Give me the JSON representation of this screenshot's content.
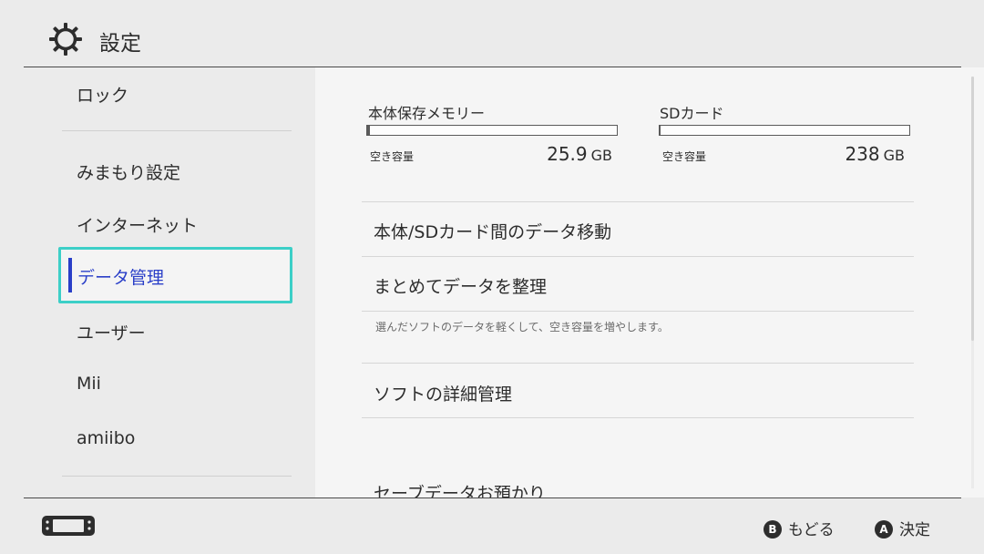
{
  "header": {
    "title": "設定",
    "icon": "gear-icon"
  },
  "sidebar": {
    "items": [
      {
        "label": "ロック"
      },
      {
        "label": "みまもり設定"
      },
      {
        "label": "インターネット"
      },
      {
        "label": "データ管理"
      },
      {
        "label": "ユーザー"
      },
      {
        "label": "Mii"
      },
      {
        "label": "amiibo"
      }
    ],
    "selected": "データ管理"
  },
  "storage": {
    "system": {
      "title": "本体保存メモリー",
      "free_label": "空き容量",
      "free_value": "25.9",
      "unit": "GB",
      "used_fraction": 0.01
    },
    "sd": {
      "title": "SDカード",
      "free_label": "空き容量",
      "free_value": "238",
      "unit": "GB",
      "used_fraction": 0.005
    }
  },
  "menu": {
    "items": [
      {
        "label": "本体/SDカード間のデータ移動"
      },
      {
        "label": "まとめてデータを整理",
        "description": "選んだソフトのデータを軽くして、空き容量を増やします。"
      },
      {
        "label": "ソフトの詳細管理"
      },
      {
        "label": "セーブデータお預かり"
      }
    ]
  },
  "footer": {
    "back": {
      "button": "B",
      "label": "もどる"
    },
    "confirm": {
      "button": "A",
      "label": "決定"
    }
  },
  "colors": {
    "accent": "#2a3fc8",
    "highlight": "#3ccfc7",
    "background": "#ebebeb"
  }
}
